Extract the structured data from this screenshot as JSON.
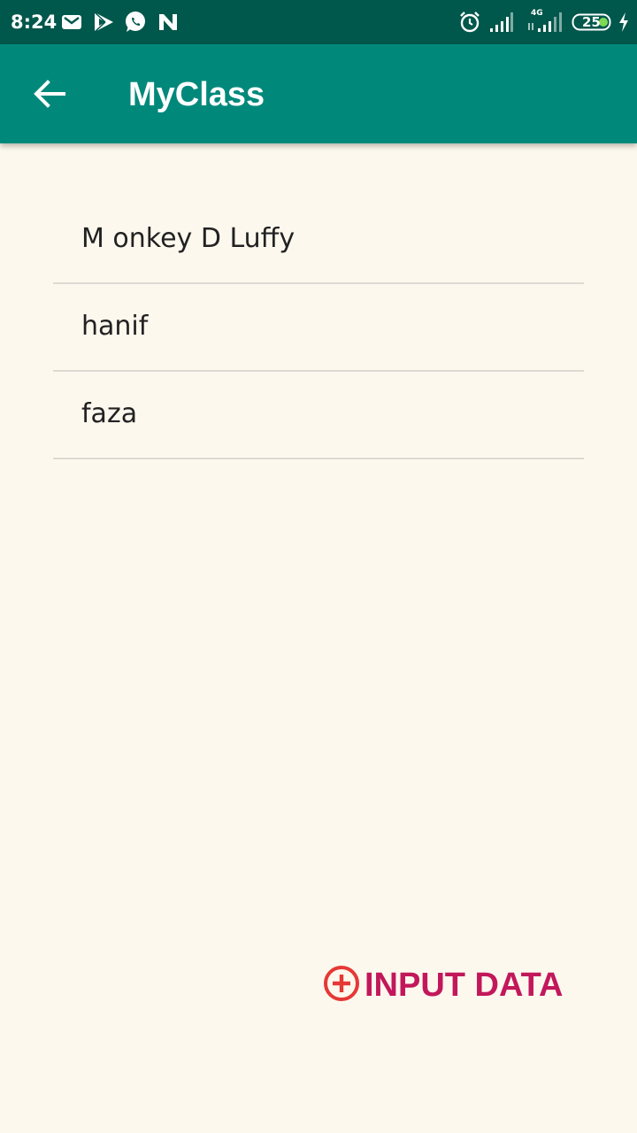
{
  "status_bar": {
    "time": "8:24",
    "left_icons": [
      "gmail-icon",
      "play-store-icon",
      "whatsapp-icon",
      "n-icon"
    ],
    "right_icons": [
      "alarm-icon",
      "signal-icon",
      "4g-signal-icon",
      "battery-icon",
      "charging-icon"
    ],
    "network_label": "4G",
    "battery_level": "25"
  },
  "app_bar": {
    "title": "MyClass",
    "back_icon": "arrow-back-icon",
    "background": "#00897b",
    "status_background": "#00574b"
  },
  "list": {
    "items": [
      {
        "label": "M onkey D Luffy"
      },
      {
        "label": "hanif"
      },
      {
        "label": "faza"
      }
    ]
  },
  "input_button": {
    "label": "INPUT DATA",
    "icon": "add-circle-icon",
    "text_color": "#c2185b",
    "icon_color": "#e53935"
  },
  "page": {
    "background": "#fdf8ee"
  }
}
